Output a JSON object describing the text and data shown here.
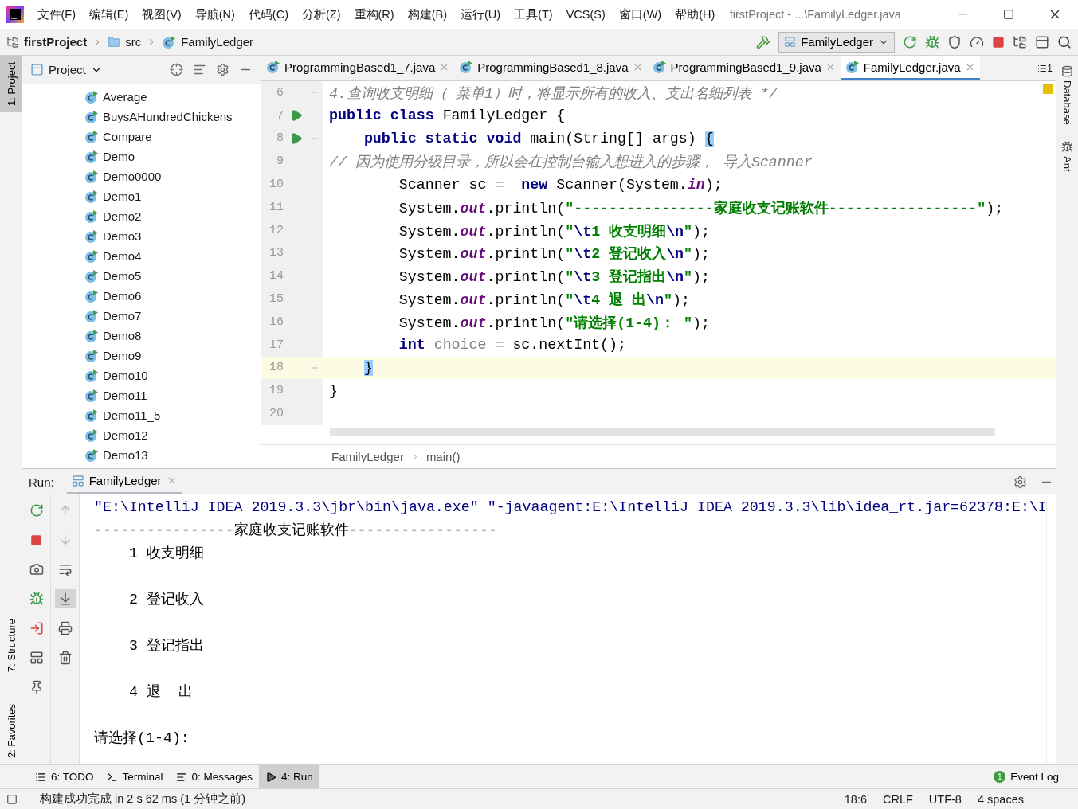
{
  "app_icon": {
    "kind": "logo"
  },
  "menu": [
    "文件(F)",
    "编辑(E)",
    "视图(V)",
    "导航(N)",
    "代码(C)",
    "分析(Z)",
    "重构(R)",
    "构建(B)",
    "运行(U)",
    "工具(T)",
    "VCS(S)",
    "窗口(W)",
    "帮助(H)"
  ],
  "window_title": "firstProject - ...\\FamilyLedger.java",
  "breadcrumb": [
    {
      "kind": "project",
      "label": "firstProject"
    },
    {
      "kind": "folder",
      "label": "src"
    },
    {
      "kind": "class",
      "label": "FamilyLedger"
    }
  ],
  "run_config": "FamilyLedger",
  "left_stripe": [
    {
      "label": "1: Project",
      "selected": true
    },
    {
      "label": "7: Structure",
      "selected": false
    },
    {
      "label": "2: Favorites",
      "selected": false
    }
  ],
  "right_stripe": [
    "Database",
    "Ant"
  ],
  "project_panel": {
    "title": "Project",
    "items": [
      "Average",
      "BuysAHundredChickens",
      "Compare",
      "Demo",
      "Demo0000",
      "Demo1",
      "Demo2",
      "Demo3",
      "Demo4",
      "Demo5",
      "Demo6",
      "Demo7",
      "Demo8",
      "Demo9",
      "Demo10",
      "Demo11",
      "Demo11_5",
      "Demo12",
      "Demo13"
    ]
  },
  "editor": {
    "tabs": [
      {
        "label": "ProgrammingBased1_7.java",
        "selected": false
      },
      {
        "label": "ProgrammingBased1_8.java",
        "selected": false
      },
      {
        "label": "ProgrammingBased1_9.java",
        "selected": false
      },
      {
        "label": "FamilyLedger.java",
        "selected": true
      }
    ],
    "tab_count": "1",
    "lines": [
      {
        "number": "6",
        "run": false,
        "fold": true,
        "current": false,
        "tokens": [
          {
            "kind": "comment",
            "text": "4.查询收支明细（ 菜单1）时，将显示所有的收入、支出名细列表 */"
          }
        ]
      },
      {
        "number": "7",
        "run": true,
        "fold": false,
        "current": false,
        "tokens": [
          {
            "kind": "keyword",
            "text": "public class "
          },
          {
            "kind": "plain",
            "text": "FamilyLedger {"
          }
        ]
      },
      {
        "number": "8",
        "run": true,
        "fold": true,
        "current": false,
        "tokens": [
          {
            "kind": "keyword",
            "text": "    public static void "
          },
          {
            "kind": "plain",
            "text": "main(String[] args) "
          },
          {
            "kind": "brace",
            "text": "{"
          }
        ]
      },
      {
        "number": "9",
        "run": false,
        "fold": false,
        "current": false,
        "tokens": [
          {
            "kind": "comment",
            "text": "// 因为使用分级目录，所以会在控制台输入想进入的步骤， 导入Scanner"
          }
        ]
      },
      {
        "number": "10",
        "run": false,
        "fold": false,
        "current": false,
        "tokens": [
          {
            "kind": "plain",
            "text": "        Scanner sc =  "
          },
          {
            "kind": "keyword",
            "text": "new "
          },
          {
            "kind": "plain",
            "text": "Scanner(System."
          },
          {
            "kind": "field",
            "text": "in"
          },
          {
            "kind": "plain",
            "text": ");"
          }
        ]
      },
      {
        "number": "11",
        "run": false,
        "fold": false,
        "current": false,
        "tokens": [
          {
            "kind": "plain",
            "text": "        System."
          },
          {
            "kind": "field",
            "text": "out"
          },
          {
            "kind": "plain",
            "text": ".println("
          },
          {
            "kind": "string",
            "text": "\"----------------家庭收支记账软件-----------------\""
          },
          {
            "kind": "plain",
            "text": ");"
          }
        ]
      },
      {
        "number": "12",
        "run": false,
        "fold": false,
        "current": false,
        "tokens": [
          {
            "kind": "plain",
            "text": "        System."
          },
          {
            "kind": "field",
            "text": "out"
          },
          {
            "kind": "plain",
            "text": ".println("
          },
          {
            "kind": "string",
            "text": "\""
          },
          {
            "kind": "escape",
            "text": "\\t"
          },
          {
            "kind": "string",
            "text": "1 收支明细"
          },
          {
            "kind": "escape",
            "text": "\\n"
          },
          {
            "kind": "string",
            "text": "\""
          },
          {
            "kind": "plain",
            "text": ");"
          }
        ]
      },
      {
        "number": "13",
        "run": false,
        "fold": false,
        "current": false,
        "tokens": [
          {
            "kind": "plain",
            "text": "        System."
          },
          {
            "kind": "field",
            "text": "out"
          },
          {
            "kind": "plain",
            "text": ".println("
          },
          {
            "kind": "string",
            "text": "\""
          },
          {
            "kind": "escape",
            "text": "\\t"
          },
          {
            "kind": "string",
            "text": "2 登记收入"
          },
          {
            "kind": "escape",
            "text": "\\n"
          },
          {
            "kind": "string",
            "text": "\""
          },
          {
            "kind": "plain",
            "text": ");"
          }
        ]
      },
      {
        "number": "14",
        "run": false,
        "fold": false,
        "current": false,
        "tokens": [
          {
            "kind": "plain",
            "text": "        System."
          },
          {
            "kind": "field",
            "text": "out"
          },
          {
            "kind": "plain",
            "text": ".println("
          },
          {
            "kind": "string",
            "text": "\""
          },
          {
            "kind": "escape",
            "text": "\\t"
          },
          {
            "kind": "string",
            "text": "3 登记指出"
          },
          {
            "kind": "escape",
            "text": "\\n"
          },
          {
            "kind": "string",
            "text": "\""
          },
          {
            "kind": "plain",
            "text": ");"
          }
        ]
      },
      {
        "number": "15",
        "run": false,
        "fold": false,
        "current": false,
        "tokens": [
          {
            "kind": "plain",
            "text": "        System."
          },
          {
            "kind": "field",
            "text": "out"
          },
          {
            "kind": "plain",
            "text": ".println("
          },
          {
            "kind": "string",
            "text": "\""
          },
          {
            "kind": "escape",
            "text": "\\t"
          },
          {
            "kind": "string",
            "text": "4 退 出"
          },
          {
            "kind": "escape",
            "text": "\\n"
          },
          {
            "kind": "string",
            "text": "\""
          },
          {
            "kind": "plain",
            "text": ");"
          }
        ]
      },
      {
        "number": "16",
        "run": false,
        "fold": false,
        "current": false,
        "tokens": [
          {
            "kind": "plain",
            "text": "        System."
          },
          {
            "kind": "field",
            "text": "out"
          },
          {
            "kind": "plain",
            "text": ".println("
          },
          {
            "kind": "string",
            "text": "\"请选择(1-4)： \""
          },
          {
            "kind": "plain",
            "text": ");"
          }
        ]
      },
      {
        "number": "17",
        "run": false,
        "fold": false,
        "current": false,
        "tokens": [
          {
            "kind": "keyword",
            "text": "        int "
          },
          {
            "kind": "unused",
            "text": "choice"
          },
          {
            "kind": "plain",
            "text": " = sc.nextInt();"
          }
        ]
      },
      {
        "number": "18",
        "run": false,
        "fold": true,
        "current": true,
        "tokens": [
          {
            "kind": "brace",
            "text": "    }"
          }
        ]
      },
      {
        "number": "19",
        "run": false,
        "fold": false,
        "current": false,
        "tokens": [
          {
            "kind": "plain",
            "text": "}"
          }
        ]
      },
      {
        "number": "20",
        "run": false,
        "fold": false,
        "current": false
      }
    ],
    "path": [
      "FamilyLedger",
      "main()"
    ]
  },
  "run_panel": {
    "label": "Run:",
    "tab": "FamilyLedger",
    "console": [
      {
        "kind": "command",
        "text": "\"E:\\IntelliJ IDEA 2019.3.3\\jbr\\bin\\java.exe\" \"-javaagent:E:\\IntelliJ IDEA 2019.3.3\\lib\\idea_rt.jar=62378:E:\\I"
      },
      {
        "kind": "output",
        "text": "----------------家庭收支记账软件-----------------"
      },
      {
        "kind": "menu",
        "text": "1 收支明细"
      },
      {
        "kind": "menu",
        "text": "2 登记收入"
      },
      {
        "kind": "menu",
        "text": "3 登记指出"
      },
      {
        "kind": "menu",
        "text": "4 退  出"
      },
      {
        "kind": "output",
        "text": "请选择(1-4):"
      }
    ]
  },
  "tool_tabs": [
    {
      "label": "6: TODO",
      "selected": false
    },
    {
      "label": "Terminal",
      "selected": false
    },
    {
      "label": "0: Messages",
      "selected": false
    },
    {
      "label": "4: Run",
      "selected": true
    }
  ],
  "event_log": {
    "label": "Event Log",
    "count": "1"
  },
  "status_bar": {
    "message": "构建成功完成 in 2 s 62 ms (1 分钟之前)",
    "position": "18:6",
    "line_separator": "CRLF",
    "encoding": "UTF-8",
    "indent": "4 spaces"
  }
}
